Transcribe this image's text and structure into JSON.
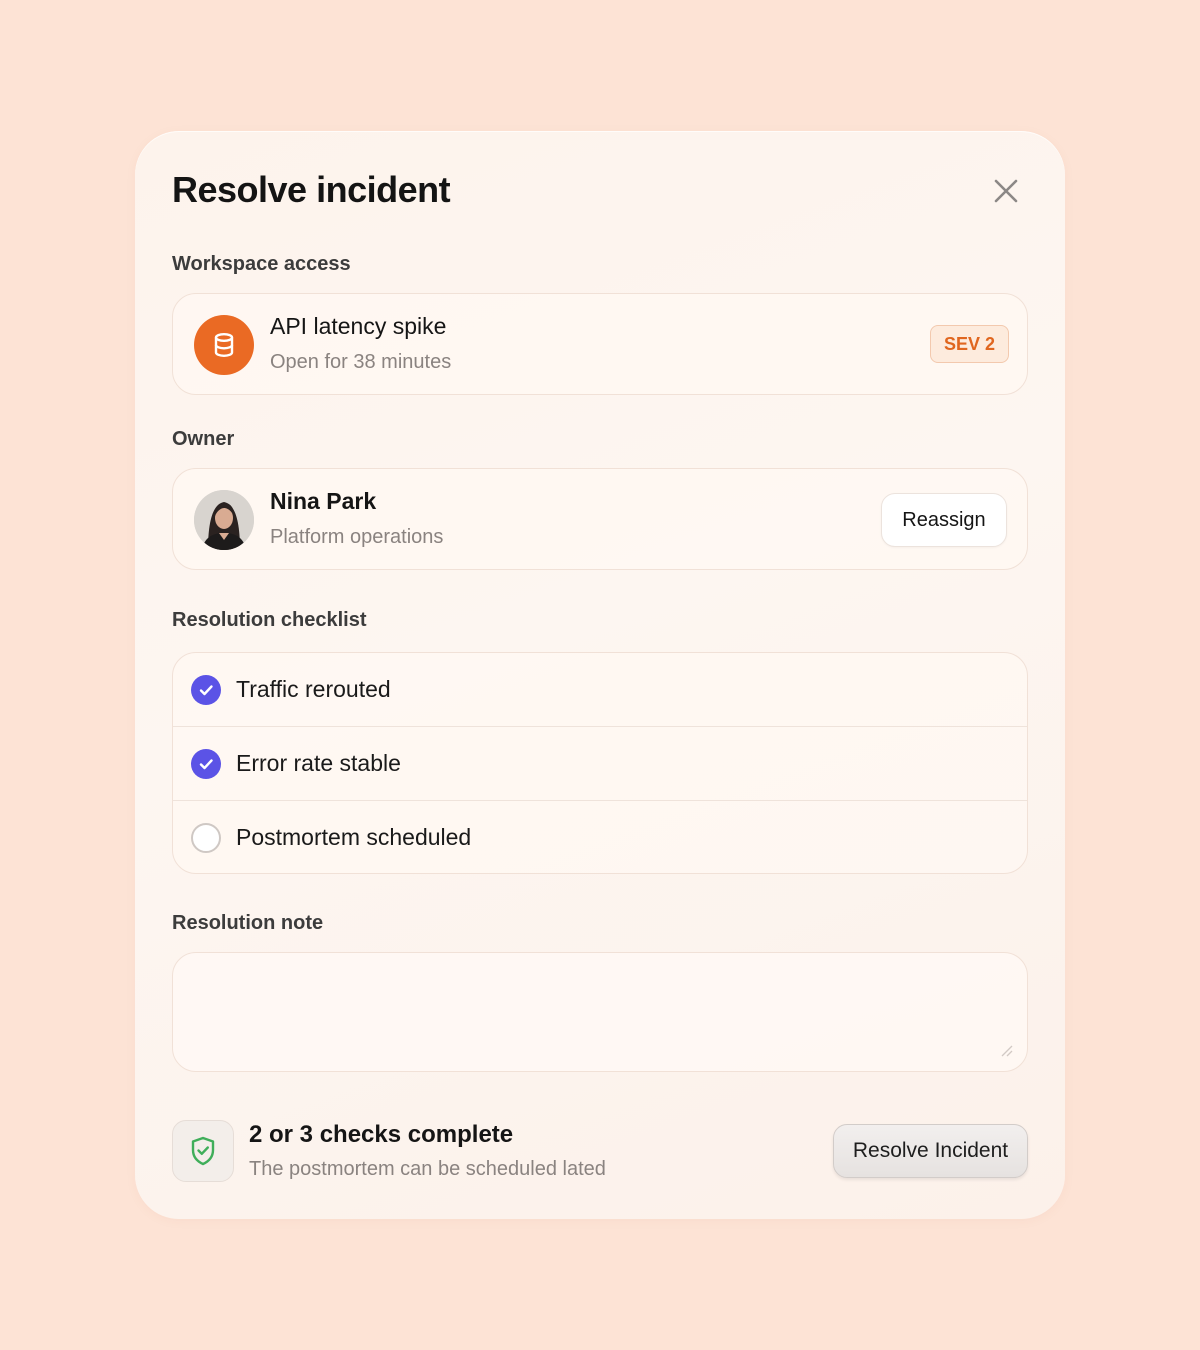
{
  "dialog": {
    "title": "Resolve incident",
    "close_icon": "close-icon"
  },
  "workspace": {
    "section_label": "Workspace access",
    "incident": {
      "icon": "database-icon",
      "title": "API latency spike",
      "subtitle": "Open for 38 minutes",
      "severity": "SEV 2"
    }
  },
  "owner": {
    "section_label": "Owner",
    "name": "Nina Park",
    "team": "Platform operations",
    "reassign_label": "Reassign"
  },
  "checklist": {
    "section_label": "Resolution checklist",
    "items": [
      {
        "label": "Traffic rerouted",
        "checked": true
      },
      {
        "label": "Error rate stable",
        "checked": true
      },
      {
        "label": "Postmortem scheduled",
        "checked": false
      }
    ]
  },
  "note": {
    "section_label": "Resolution note",
    "value": "",
    "placeholder": ""
  },
  "footer": {
    "status_icon": "shield-check-icon",
    "status_title": "2 or 3 checks complete",
    "status_subtitle": "The postmortem can be scheduled lated",
    "resolve_label": "Resolve Incident"
  },
  "colors": {
    "background": "#fde3d5",
    "accent": "#5b53e6",
    "incident_icon": "#ea6a24",
    "severity_text": "#e0661f",
    "shield": "#3fae5a"
  }
}
